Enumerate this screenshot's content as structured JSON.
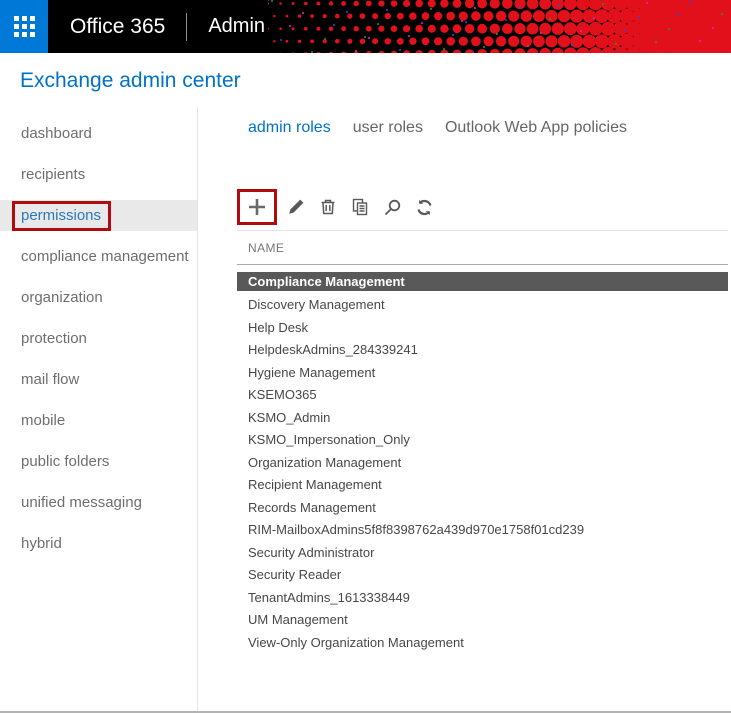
{
  "topbar": {
    "brand": "Office 365",
    "section": "Admin"
  },
  "page": {
    "title": "Exchange admin center"
  },
  "sidebar": {
    "items": [
      {
        "label": "dashboard"
      },
      {
        "label": "recipients"
      },
      {
        "label": "permissions",
        "selected": true,
        "annotated": true
      },
      {
        "label": "compliance management"
      },
      {
        "label": "organization"
      },
      {
        "label": "protection"
      },
      {
        "label": "mail flow"
      },
      {
        "label": "mobile"
      },
      {
        "label": "public folders"
      },
      {
        "label": "unified messaging"
      },
      {
        "label": "hybrid"
      }
    ]
  },
  "tabs": [
    {
      "label": "admin roles",
      "selected": true
    },
    {
      "label": "user roles"
    },
    {
      "label": "Outlook Web App policies"
    }
  ],
  "toolbar": {
    "icons": [
      {
        "name": "add",
        "annotated": true
      },
      {
        "name": "edit"
      },
      {
        "name": "delete"
      },
      {
        "name": "copy"
      },
      {
        "name": "search"
      },
      {
        "name": "refresh"
      }
    ]
  },
  "table": {
    "header": "NAME",
    "rows": [
      {
        "name": "Compliance Management",
        "selected": true
      },
      {
        "name": "Discovery Management"
      },
      {
        "name": "Help Desk"
      },
      {
        "name": "HelpdeskAdmins_284339241"
      },
      {
        "name": "Hygiene Management"
      },
      {
        "name": "KSEMO365"
      },
      {
        "name": "KSMO_Admin"
      },
      {
        "name": "KSMO_Impersonation_Only"
      },
      {
        "name": "Organization Management"
      },
      {
        "name": "Recipient Management"
      },
      {
        "name": "Records Management"
      },
      {
        "name": "RIM-MailboxAdmins5f8f8398762a439d970e1758f01cd239"
      },
      {
        "name": "Security Administrator"
      },
      {
        "name": "Security Reader"
      },
      {
        "name": "TenantAdmins_1613338449"
      },
      {
        "name": "UM Management"
      },
      {
        "name": "View-Only Organization Management"
      }
    ]
  },
  "colors": {
    "topbar_bg": "#000000",
    "launcher_blue": "#0078d7",
    "accent_blue": "#0072c6",
    "annotation_red": "#b00c10",
    "selected_row_bg": "#595959",
    "pattern_red": "#e1101a"
  }
}
